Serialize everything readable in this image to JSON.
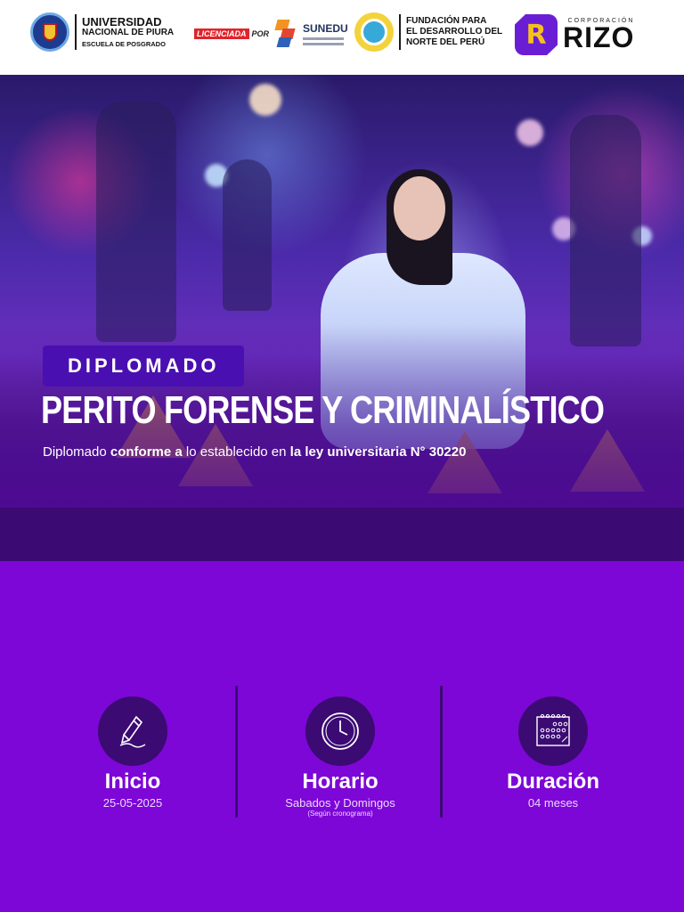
{
  "header": {
    "unp": {
      "line1": "UNIVERSIDAD",
      "line2": "NACIONAL DE PIURA",
      "line3": "ESCUELA DE POSGRADO"
    },
    "sunedu": {
      "licenciada": "LICENCIADA",
      "por": "POR",
      "brand": "SUNEDU"
    },
    "fundacion": {
      "line1": "FUNDACIÓN PARA",
      "line2": "EL DESARROLLO DEL",
      "line3": "NORTE DEL PERÚ"
    },
    "rizo": {
      "corporacion": "CORPORACIÓN",
      "brand": "RIZO",
      "mark_letter": "R"
    }
  },
  "hero": {
    "badge": "DIPLOMADO",
    "title": "PERITO FORENSE Y CRIMINALÍSTICO",
    "subtitle": {
      "part1": "Diplomado ",
      "part2": "conforme a",
      "part3": " lo establecido en ",
      "part4": "la ley universitaria N° 30220"
    }
  },
  "info": {
    "inicio": {
      "label": "Inicio",
      "value": "25-05-2025",
      "icon": "pen-icon"
    },
    "horario": {
      "label": "Horario",
      "value": "Sabados y Domingos",
      "note": "(Según cronograma)",
      "icon": "clock-icon"
    },
    "duracion": {
      "label": "Duración",
      "value": "04 meses",
      "icon": "calendar-icon"
    }
  },
  "colors": {
    "background": "#7d07d6",
    "band": "#3b0a73",
    "badge": "#4a0fb0",
    "rizo_purple": "#6a1ed4",
    "rizo_yellow": "#f6c219"
  }
}
